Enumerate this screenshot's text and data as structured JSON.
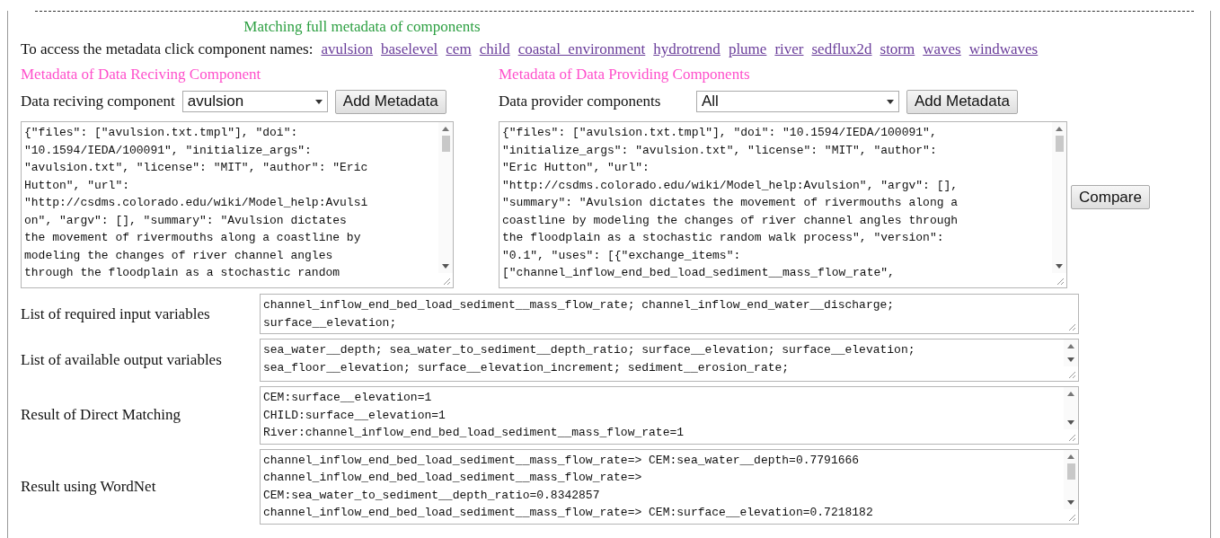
{
  "title": "Matching full metadata of components",
  "access": {
    "label": "To access the metadata click component names:",
    "links": [
      "avulsion",
      "baselevel",
      "cem",
      "child",
      "coastal_environment",
      "hydrotrend",
      "plume",
      "river",
      "sedflux2d",
      "storm",
      "waves",
      "windwaves"
    ]
  },
  "receiving": {
    "heading": "Metadata of Data Reciving Component",
    "label": "Data reciving component",
    "select": "avulsion",
    "button": "Add Metadata",
    "field": {
      "kind": "thumb",
      "lines": [
        "{\"files\": [\"avulsion.txt.tmpl\"], \"doi\":",
        "\"10.1594/IEDA/100091\", \"initialize_args\":",
        "\"avulsion.txt\", \"license\": \"MIT\", \"author\": \"Eric",
        "Hutton\", \"url\":",
        "\"http://csdms.colorado.edu/wiki/Model_help:Avulsi",
        "on\", \"argv\": [], \"summary\": \"Avulsion dictates",
        "the movement of rivermouths along a coastline by",
        "modeling the changes of river channel angles",
        "through the floodplain as a stochastic random"
      ]
    }
  },
  "providing": {
    "heading": "Metadata of Data Providing Components",
    "label": "Data provider components",
    "select": "All",
    "button": "Add Metadata",
    "compare": "Compare",
    "field": {
      "kind": "thumb",
      "lines": [
        "{\"files\": [\"avulsion.txt.tmpl\"], \"doi\": \"10.1594/IEDA/100091\",",
        "\"initialize_args\": \"avulsion.txt\", \"license\": \"MIT\", \"author\":",
        "\"Eric Hutton\", \"url\":",
        "\"http://csdms.colorado.edu/wiki/Model_help:Avulsion\", \"argv\": [],",
        "\"summary\": \"Avulsion dictates the movement of rivermouths along a",
        "coastline by modeling the changes of river channel angles through",
        "the floodplain as a stochastic random walk process\", \"version\":",
        "\"0.1\", \"uses\": [{\"exchange_items\":",
        "[\"channel_inflow_end_bed_load_sediment__mass_flow_rate\","
      ]
    }
  },
  "results": [
    {
      "label": "List of required input variables",
      "kind": "plain",
      "lines": [
        "channel_inflow_end_bed_load_sediment__mass_flow_rate; channel_inflow_end_water__discharge;",
        "surface__elevation;"
      ]
    },
    {
      "label": "List of available output variables",
      "kind": "arrows",
      "lines": [
        "sea_water__depth; sea_water_to_sediment__depth_ratio; surface__elevation; surface__elevation;",
        "sea_floor__elevation; surface__elevation_increment; sediment__erosion_rate;"
      ]
    },
    {
      "label": "Result of Direct Matching",
      "kind": "arrows",
      "lines": [
        "CEM:surface__elevation=1",
        "CHILD:surface__elevation=1",
        "River:channel_inflow_end_bed_load_sediment__mass_flow_rate=1"
      ]
    },
    {
      "label": "Result using WordNet",
      "kind": "thumb",
      "lines": [
        "channel_inflow_end_bed_load_sediment__mass_flow_rate=> CEM:sea_water__depth=0.7791666",
        "channel_inflow_end_bed_load_sediment__mass_flow_rate=>",
        "CEM:sea_water_to_sediment__depth_ratio=0.8342857",
        "channel_inflow_end_bed_load_sediment__mass_flow_rate=> CEM:surface__elevation=0.7218182"
      ]
    }
  ]
}
